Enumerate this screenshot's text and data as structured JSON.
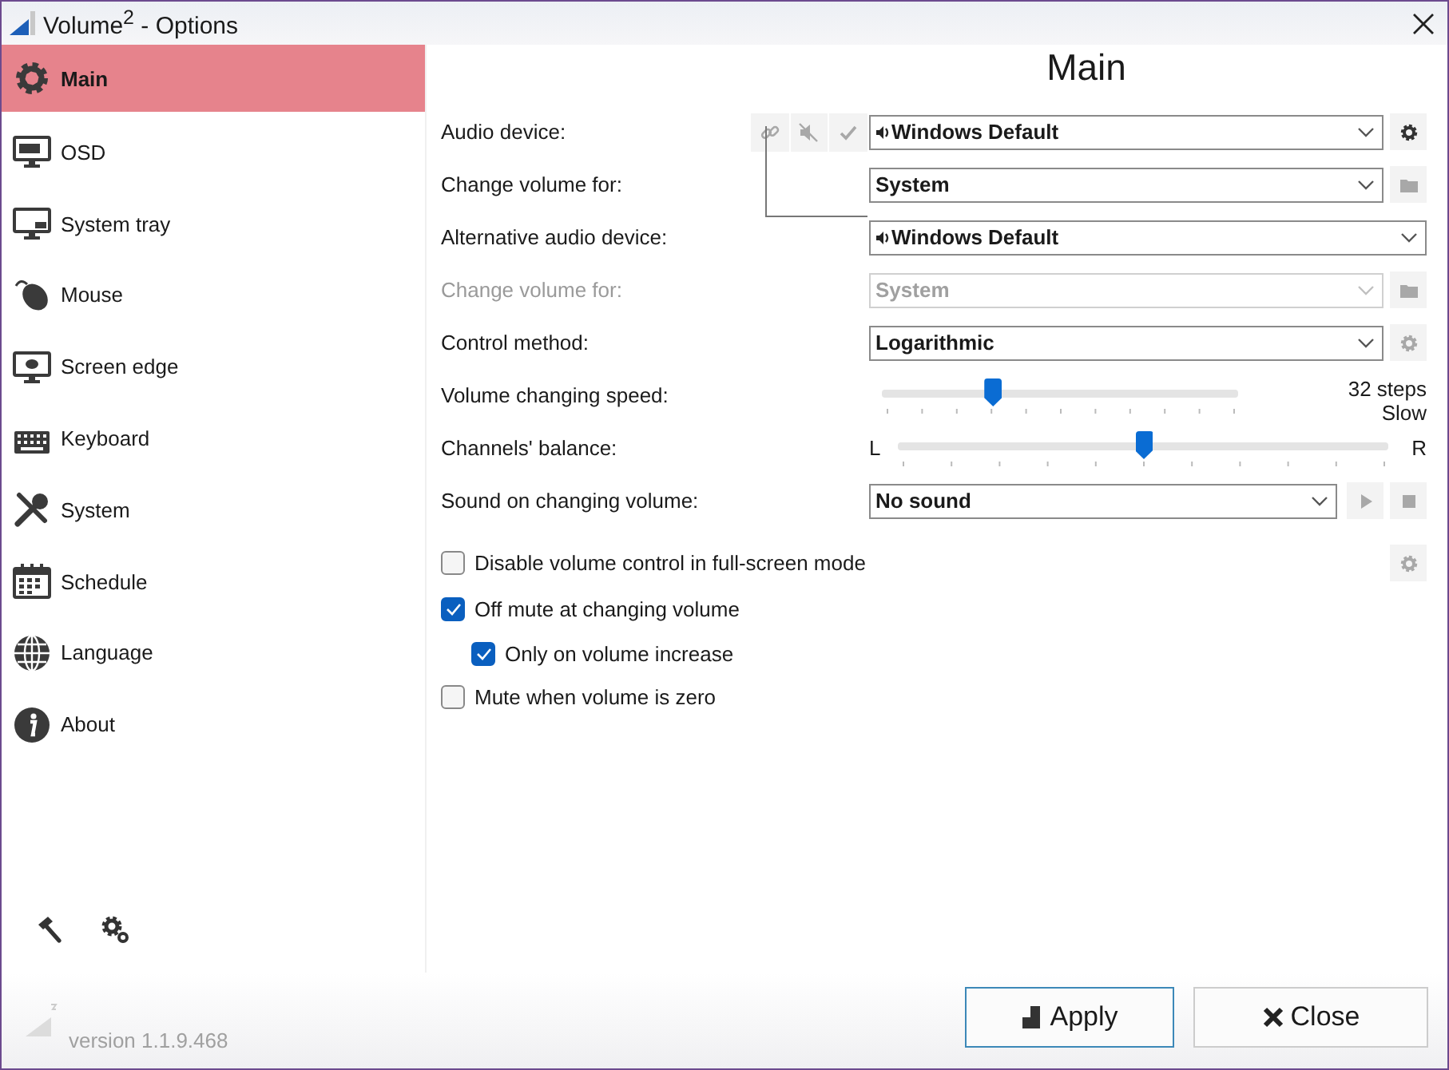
{
  "window": {
    "title": "Volume$^{2}$ - Options"
  },
  "sidebar": {
    "items": [
      {
        "label": "Main",
        "selected": true
      },
      {
        "label": "OSD",
        "selected": false
      },
      {
        "label": "System tray",
        "selected": false
      },
      {
        "label": "Mouse",
        "selected": false
      },
      {
        "label": "Screen edge",
        "selected": false
      },
      {
        "label": "Keyboard",
        "selected": false
      },
      {
        "label": "System",
        "selected": false
      },
      {
        "label": "Schedule",
        "selected": false
      },
      {
        "label": "Language",
        "selected": false
      },
      {
        "label": "About",
        "selected": false
      }
    ]
  },
  "page_title": "Main",
  "settings": [
    {
      "kind": "dropdown",
      "label": "Audio device:",
      "value": "Windows Default",
      "speaker": true,
      "disabled": false,
      "tools": [
        {
          "kind": "link",
          "disabled": true
        },
        {
          "kind": "mute",
          "disabled": true
        },
        {
          "kind": "check",
          "disabled": true
        }
      ],
      "side_buttons": [
        {
          "kind": "gear",
          "disabled": false
        }
      ]
    },
    {
      "kind": "dropdown",
      "label": "Change volume for:",
      "value": "System",
      "speaker": false,
      "disabled": false,
      "side_buttons": [
        {
          "kind": "folder",
          "disabled": true
        }
      ]
    },
    {
      "kind": "dropdown",
      "label": "Alternative audio device:",
      "value": "Windows Default",
      "speaker": true,
      "disabled": false,
      "wide": true
    },
    {
      "kind": "dropdown",
      "label": "Change volume for:",
      "value": "System",
      "speaker": false,
      "disabled": true,
      "side_buttons": [
        {
          "kind": "folder",
          "disabled": true
        }
      ]
    },
    {
      "kind": "dropdown",
      "label": "Control method:",
      "value": "Logarithmic",
      "speaker": false,
      "disabled": false,
      "side_buttons": [
        {
          "kind": "gear",
          "disabled": true
        }
      ]
    },
    {
      "kind": "slider",
      "label": "Volume changing speed:",
      "level": 0.31,
      "reading": "32 steps",
      "note": "Slow"
    },
    {
      "kind": "balance",
      "label": "Channels' balance:",
      "level": 0.5,
      "left": "L",
      "right": "R"
    },
    {
      "kind": "dropdown",
      "label": "Sound on changing volume:",
      "value": "No sound",
      "speaker": false,
      "disabled": false,
      "side_buttons": [
        {
          "kind": "play",
          "disabled": true
        },
        {
          "kind": "stop",
          "disabled": true
        }
      ]
    }
  ],
  "options": [
    {
      "label": "Disable volume control in full-screen mode",
      "checked": false,
      "side_button": {
        "kind": "gear",
        "disabled": true
      }
    },
    {
      "label": "Off mute at changing volume",
      "checked": true,
      "children": [
        {
          "label": "Only on volume increase",
          "checked": true
        }
      ]
    },
    {
      "label": "Mute when volume is zero",
      "checked": false
    }
  ],
  "footer": {
    "version": "version 1.1.9.468",
    "buttons": [
      {
        "kind": "apply",
        "label": "Apply"
      },
      {
        "kind": "close",
        "label": "Close"
      }
    ]
  }
}
